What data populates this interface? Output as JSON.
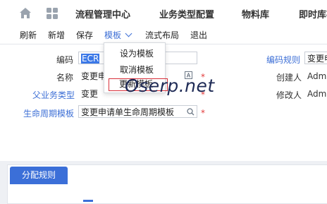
{
  "topnav": {
    "tabs": [
      "流程管理中心",
      "业务类型配置",
      "物料库",
      "即时库存"
    ]
  },
  "toolbar": {
    "refresh": "刷新",
    "add": "新增",
    "save": "保存",
    "template": "模板",
    "flow_layout": "流式布局",
    "exit": "退出"
  },
  "template_menu": {
    "items": [
      "设为模板",
      "取消模板",
      "更新模板"
    ]
  },
  "form": {
    "code_label": "编码",
    "code_value": "ECR",
    "name_label": "名称",
    "name_value": "变更申",
    "parent_type_label": "父业务类型",
    "parent_type_value": "变更",
    "lifecycle_label": "生命周期模板",
    "lifecycle_value": "变更申请单生命周期模板",
    "coding_rule_label": "编码规则",
    "coding_rule_value": "变更申",
    "creator_label": "创建人",
    "creator_value": "Adm",
    "modifier_label": "修改人",
    "modifier_value": "Adm"
  },
  "watermark": "Oserp.net",
  "bottom": {
    "tab_label": "分配规则"
  },
  "colors": {
    "accent": "#3d6fd6",
    "required": "#e23b3b",
    "highlight_box": "#d8303a"
  }
}
